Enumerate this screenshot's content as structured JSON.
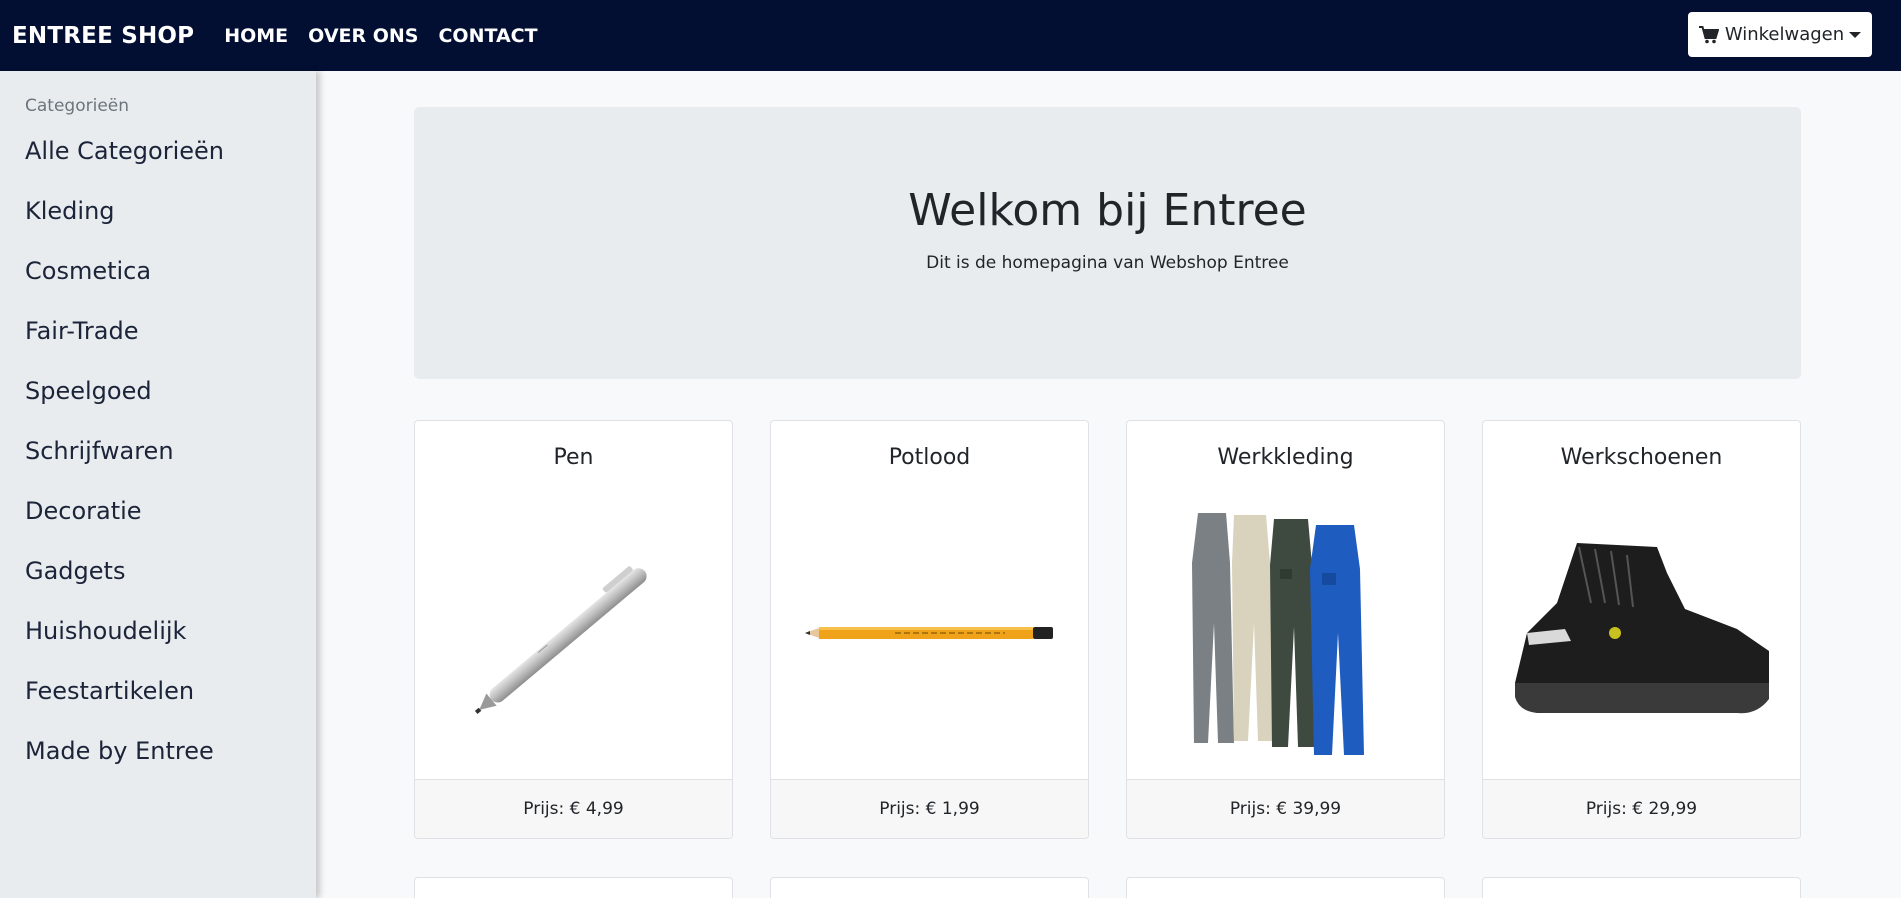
{
  "navbar": {
    "brand": "ENTREE SHOP",
    "links": [
      "HOME",
      "OVER ONS",
      "CONTACT"
    ],
    "cart_label": "Winkelwagen"
  },
  "sidebar": {
    "heading": "Categorieën",
    "items": [
      "Alle Categorieën",
      "Kleding",
      "Cosmetica",
      "Fair-Trade",
      "Speelgoed",
      "Schrijfwaren",
      "Decoratie",
      "Gadgets",
      "Huishoudelijk",
      "Feestartikelen",
      "Made by Entree"
    ]
  },
  "hero": {
    "title": "Welkom bij Entree",
    "subtitle": "Dit is de homepagina van Webshop Entree"
  },
  "products": [
    {
      "name": "Pen",
      "price": "Prijs: € 4,99",
      "image": "pen-image"
    },
    {
      "name": "Potlood",
      "price": "Prijs: € 1,99",
      "image": "pencil-image"
    },
    {
      "name": "Werkkleding",
      "price": "Prijs: € 39,99",
      "image": "workwear-image"
    },
    {
      "name": "Werkschoenen",
      "price": "Prijs: € 29,99",
      "image": "work-shoe-image"
    }
  ],
  "colors": {
    "navbar": "#020f33",
    "sidebar": "#e9ecef",
    "hero": "#e9ecef",
    "background": "#f8f9fa"
  }
}
